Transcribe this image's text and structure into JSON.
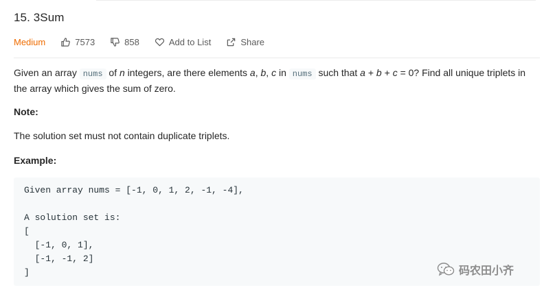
{
  "problem": {
    "title": "15. 3Sum",
    "difficulty": "Medium",
    "likes": "7573",
    "dislikes": "858",
    "add_to_list_label": "Add to List",
    "share_label": "Share"
  },
  "description": {
    "p1_part1": "Given an array ",
    "p1_code1": "nums",
    "p1_part2": " of ",
    "p1_var_n": "n",
    "p1_part3": " integers, are there elements ",
    "p1_var_a": "a",
    "p1_sep1": ", ",
    "p1_var_b": "b",
    "p1_sep2": ", ",
    "p1_var_c": "c",
    "p1_part4": " in ",
    "p1_code2": "nums",
    "p1_part5": " such that ",
    "p1_eq_a": "a",
    "p1_eq_plus1": " + ",
    "p1_eq_b": "b",
    "p1_eq_plus2": " + ",
    "p1_eq_c": "c",
    "p1_part6": " = 0? Find all unique triplets in the array which gives the sum of zero.",
    "note_heading": "Note:",
    "note_text": "The solution set must not contain duplicate triplets.",
    "example_heading": "Example:"
  },
  "example_code": [
    "Given array nums = [-1, 0, 1, 2, -1, -4],",
    "",
    "A solution set is:",
    "[",
    "  [-1, 0, 1],",
    "  [-1, -1, 2]",
    "]"
  ],
  "watermark": {
    "text": "码农田小齐",
    "icon": "wechat-icon"
  },
  "colors": {
    "difficulty_medium": "#ef6c00",
    "code_background": "#f7f9fa",
    "inline_code_text": "#546e7a"
  }
}
